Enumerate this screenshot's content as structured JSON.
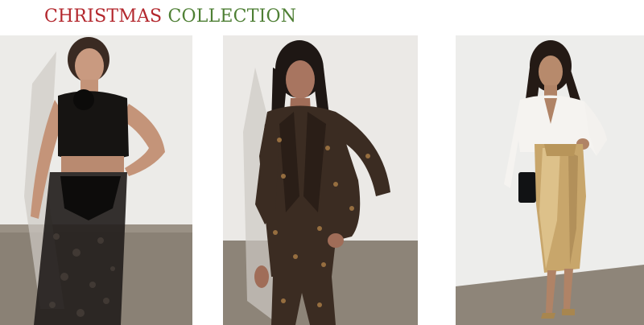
{
  "heading": {
    "word_red": "CHRISTMAS",
    "word_green": "COLLECTION",
    "color_red": "#b3272d",
    "color_green": "#4e7f34"
  },
  "products": [
    {
      "image": "model-black-lace-sheer-dress-photo",
      "outfit": "black lace set"
    },
    {
      "image": "model-metallic-floral-jacquard-suit-photo",
      "outfit": "brocade suit"
    },
    {
      "image": "model-white-blouse-gold-satin-skirt-photo",
      "outfit": "gold skirt"
    }
  ]
}
